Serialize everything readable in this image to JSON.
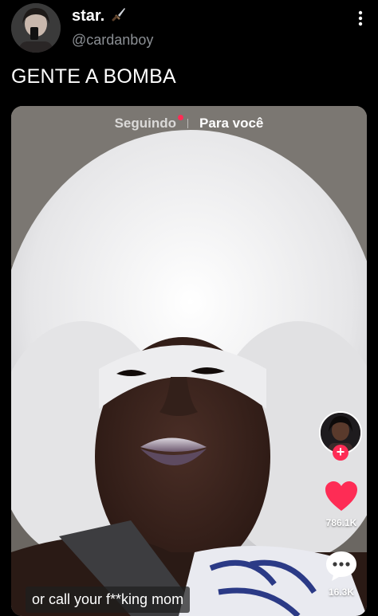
{
  "tweet": {
    "display_name": "star.",
    "name_emoji": "🗡️",
    "handle": "@cardanboy",
    "text": "GENTE A BOMBA",
    "more_icon": "more-vertical-icon"
  },
  "video": {
    "tabs": {
      "following": "Seguindo",
      "for_you": "Para você"
    },
    "likes": "786.1K",
    "comments": "16.3K",
    "caption": "or call your f**king mom",
    "colors": {
      "like": "#fe2c55",
      "accent": "#fe2c55"
    }
  }
}
